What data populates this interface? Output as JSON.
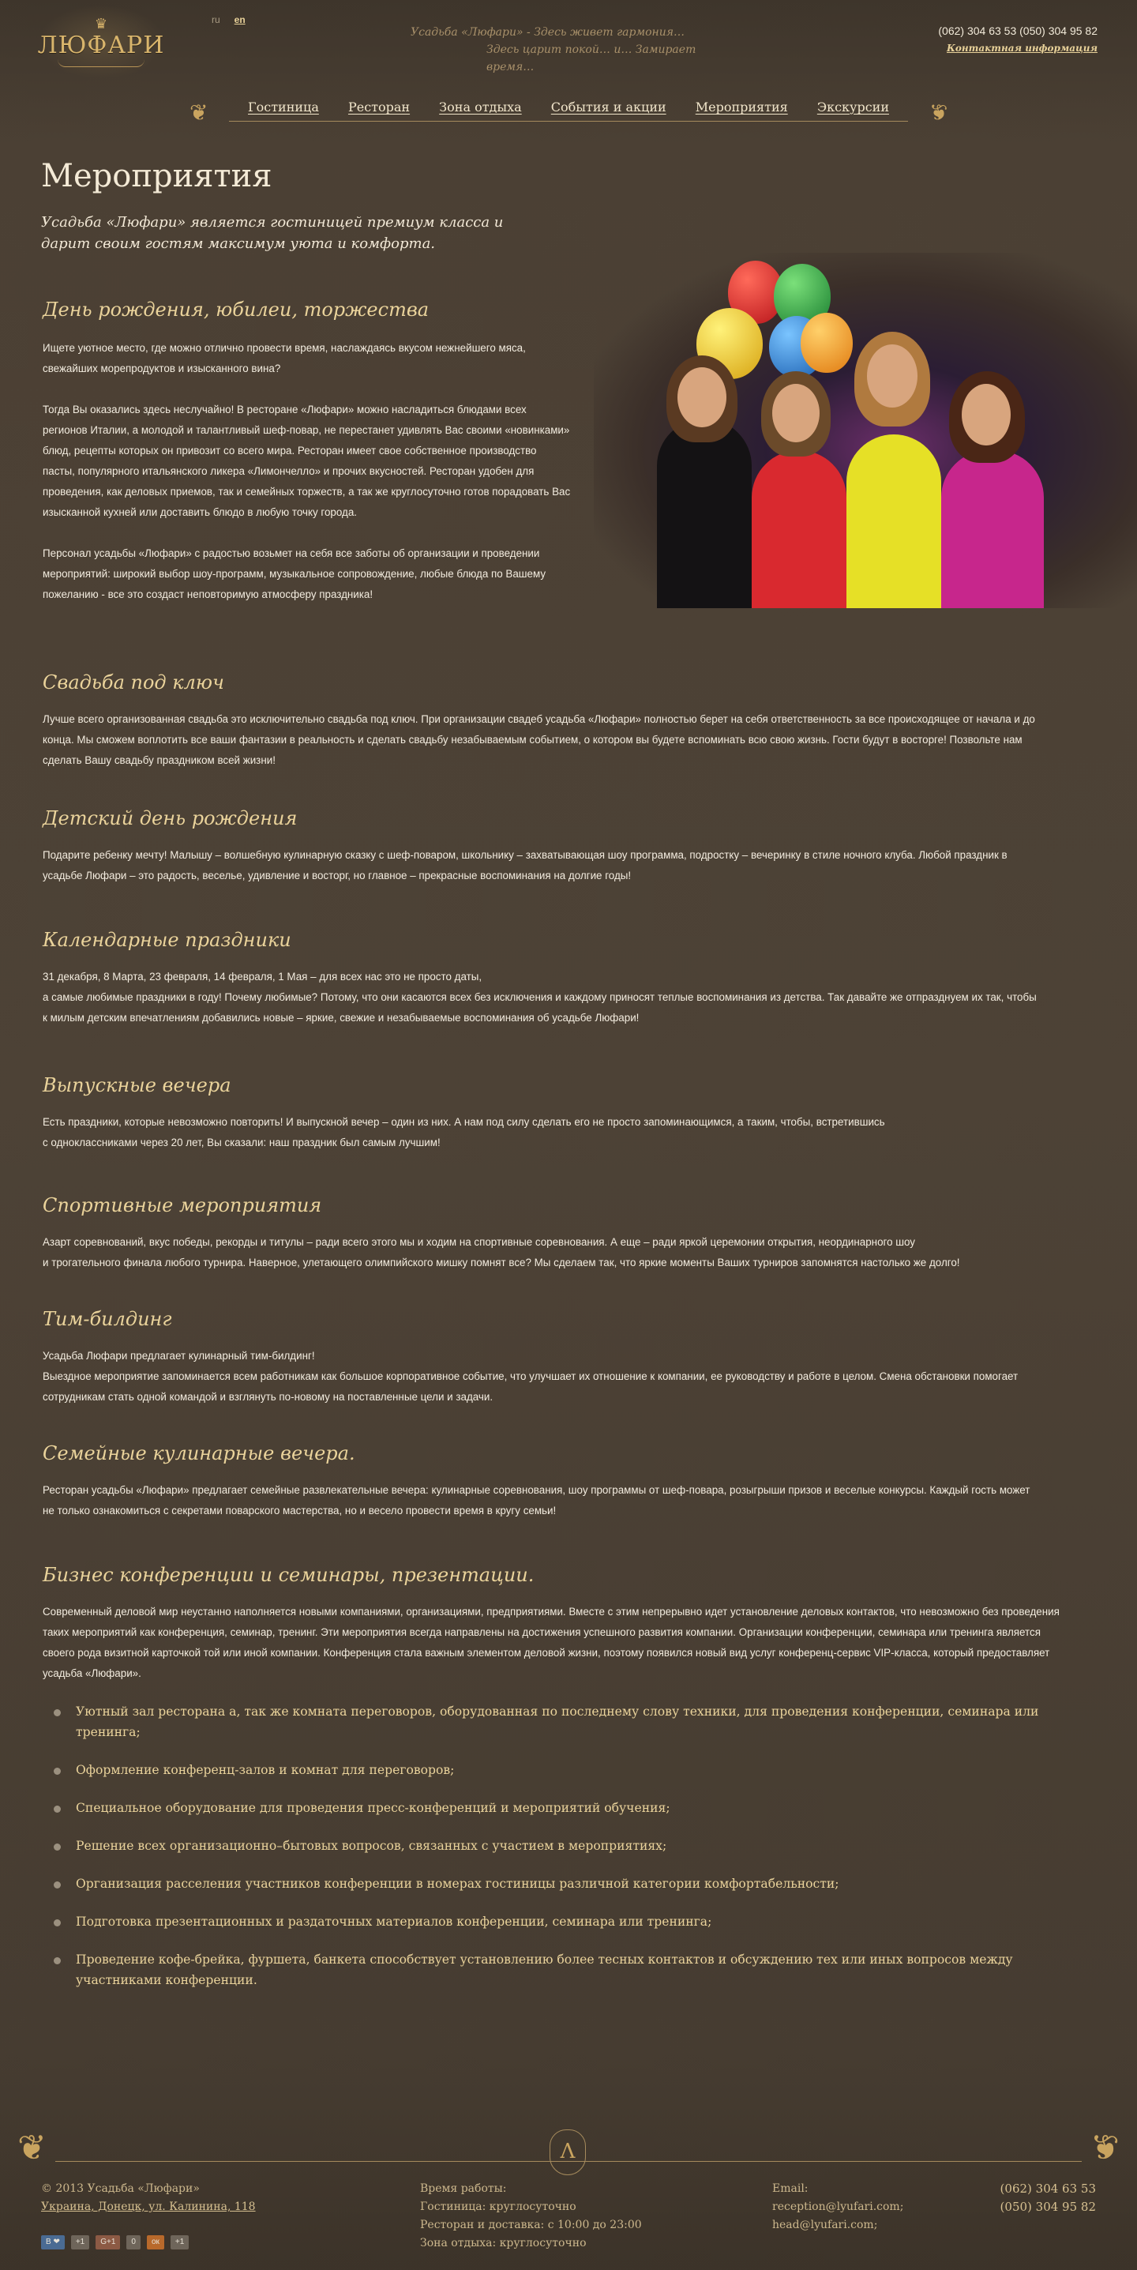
{
  "header": {
    "logo_text": "ЛЮФАРИ",
    "lang": {
      "ru": "ru",
      "en": "en"
    },
    "slogan_line1": "Усадьба «Люфари» - Здесь живет гармония…",
    "slogan_line2": "Здесь царит покой… и… Замирает время…",
    "phones": "(062) 304 63 53  (050) 304 95 82",
    "contact_link": "Контактная информация"
  },
  "nav": {
    "items": [
      {
        "label": "Гостиница"
      },
      {
        "label": "Ресторан"
      },
      {
        "label": "Зона отдыха"
      },
      {
        "label": "События и акции"
      },
      {
        "label": "Мероприятия"
      },
      {
        "label": "Экскурсии"
      }
    ]
  },
  "main": {
    "title": "Мероприятия",
    "intro": "Усадьба «Люфари» является гостиницей премиум класса и дарит своим гостям максимум уюта и комфорта.",
    "sections": [
      {
        "heading": "День рождения, юбилеи, торжества",
        "p1": "Ищете уютное место, где можно отлично провести время, наслаждаясь вкусом нежнейшего мяса, свежайших морепродуктов и изысканного вина?",
        "p2": "Тогда Вы оказались здесь неслучайно! В ресторане «Люфари»  можно насладиться блюдами всех регионов Италии, а  молодой и талантливый шеф-повар, не перестанет удивлять Вас своими «новинками» блюд, рецепты которых он привозит со всего мира. Ресторан имеет свое собственное производство пасты, популярного итальянского ликера  «Лимончелло» и прочих вкусностей. Ресторан удобен для проведения, как деловых приемов, так и семейных торжеств, а так же круглосуточно готов порадовать Вас изысканной кухней или доставить блюдо в любую точку города.",
        "p3": "Персонал усадьбы «Люфари» с радостью возьмет на себя все заботы об организации и проведении мероприятий: широкий выбор шоу-программ, музыкальное сопровождение, любые блюда по Вашему пожеланию - все это создаст неповторимую атмосферу праздника!"
      },
      {
        "heading": "Свадьба под ключ",
        "p1": "Лучше всего организованная свадьба это исключительно свадьба под ключ. При организации свадеб усадьба «Люфари» полностью берет на себя ответственность за все происходящее от начала и до конца. Мы сможем воплотить все ваши фантазии в реальность и сделать свадьбу незабываемым событием, о котором вы будете вспоминать всю свою жизнь. Гости будут в восторге! Позвольте нам сделать Вашу свадьбу праздником всей жизни!"
      },
      {
        "heading": "Детский день рождения",
        "p1": "Подарите ребенку мечту! Малышу – волшебную кулинарную сказку с шеф-поваром, школьнику – захватывающая шоу программа, подростку – вечеринку в стиле ночного клуба. Любой праздник в усадьбе Люфари – это радость, веселье, удивление и восторг, но главное – прекрасные воспоминания на долгие годы!"
      },
      {
        "heading": "Календарные праздники",
        "p1": "31 декабря, 8 Марта, 23 февраля, 14 февраля, 1 Мая – для всех нас это не просто даты,",
        "p2": "а самые любимые праздники в году! Почему любимые? Потому, что они касаются всех без исключения и каждому приносят теплые воспоминания из детства. Так давайте же отпразднуем их так, чтобы к милым детским впечатлениям добавились новые – яркие, свежие и незабываемые воспоминания об усадьбе Люфари!"
      },
      {
        "heading": "Выпускные вечера",
        "p1": "Есть праздники, которые невозможно повторить! И выпускной вечер – один из них. А нам под силу сделать его не просто запоминающимся, а таким, чтобы, встретившись",
        "p2": "с одноклассниками через 20 лет, Вы сказали: наш праздник был самым лучшим!"
      },
      {
        "heading": "Спортивные мероприятия",
        "p1": "Азарт соревнований, вкус победы, рекорды и титулы – ради всего этого мы и ходим на спортивные соревнования. А еще – ради яркой церемонии открытия, неординарного шоу",
        "p2": "и трогательного финала любого турнира. Наверное, улетающего олимпийского мишку помнят все?  Мы сделаем так, что яркие моменты Ваших турниров запомнятся настолько же долго!"
      },
      {
        "heading": "Тим-билдинг",
        "p1": "Усадьба Люфари предлагает кулинарный тим-билдинг!",
        "p2": "Выездное мероприятие запоминается всем работникам как большое корпоративное событие, что улучшает их отношение к компании, ее руководству и работе в целом. Смена обстановки помогает сотрудникам стать одной командой и взглянуть по-новому на поставленные цели и задачи."
      },
      {
        "heading": "Семейные кулинарные вечера.",
        "p1": "Ресторан усадьбы «Люфари» предлагает семейные развлекательные вечера: кулинарные соревнования, шоу программы от шеф-повара, розыгрыши призов и веселые конкурсы. Каждый гость может не только ознакомиться с секретами поварского мастерства, но и весело провести время в кругу семьи!"
      },
      {
        "heading": "Бизнес конференции и семинары, презентации.",
        "p1": "Современный деловой мир неустанно наполняется новыми компаниями, организациями, предприятиями. Вместе с этим непрерывно идет установление деловых контактов, что невозможно без проведения таких мероприятий как конференция, семинар, тренинг. Эти мероприятия всегда направлены на достижения успешного развития компании. Организации конференции, семинара или тренинга является своего рода визитной карточкой той или иной компании. Конференция стала важным элементом деловой жизни, поэтому появился новый вид услуг конференц-сервис VIP-класса, который предоставляет усадьба «Люфари».",
        "bullets": [
          "Уютный зал ресторана а, так же комната переговоров, оборудованная по последнему слову техники, для проведения конференции, семинара или тренинга;",
          "Оформление конференц-залов и комнат для переговоров;",
          "Специальное оборудование для проведения пресс-конференций и мероприятий обучения;",
          "Решение всех организационно–бытовых вопросов, связанных с участием в мероприятиях;",
          "Организация расселения участников конференции в номерах гостиницы различной категории комфортабельности;",
          "Подготовка презентационных и раздаточных материалов конференции, семинара или тренинга;",
          "Проведение кофе-брейка, фуршета, банкета способствует установлению более тесных контактов и обсуждению тех или иных вопросов между участниками конференции."
        ]
      }
    ]
  },
  "footer": {
    "copyright": "© 2013 Усадьба «Люфари»",
    "address": "Украина, Донецк, ул. Калинина, 118",
    "hours_title": "Время работы:",
    "hours_hotel": "Гостиница: круглосуточно",
    "hours_restaurant": "Ресторан и доставка: с 10:00 до 23:00",
    "hours_zone": "Зона отдыха: круглосуточно",
    "email_title": "Email:",
    "email1": "reception@lyufari.com;",
    "email2": "head@lyufari.com;",
    "phone1": "(062) 304 63 53",
    "phone2": "(050) 304 95 82",
    "social": {
      "vk": "В ❤",
      "vk_count": "+1",
      "gp": "G+1",
      "gp_count": "0",
      "od": "ок",
      "od_count": "+1"
    }
  },
  "colors": {
    "background": "#4a3f33",
    "accent": "#e9d29a",
    "text": "#f3ecdf"
  }
}
